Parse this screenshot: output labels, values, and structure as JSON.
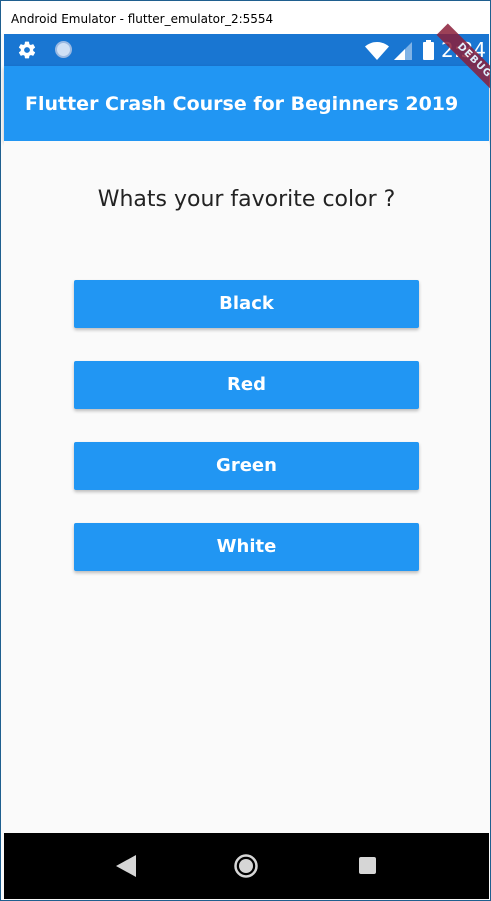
{
  "window": {
    "title": "Android Emulator - flutter_emulator_2:5554"
  },
  "status_bar": {
    "time": "2:34",
    "icons": [
      "gear-icon",
      "sync-indicator-icon",
      "wifi-icon",
      "signal-icon",
      "battery-icon"
    ],
    "color": "#1976d2"
  },
  "app_bar": {
    "title": "Flutter Crash Course for Beginners 2019",
    "debug_banner": "DEBUG",
    "color": "#2196f3"
  },
  "quiz": {
    "question": "Whats your favorite color ?",
    "answers": [
      "Black",
      "Red",
      "Green",
      "White"
    ]
  },
  "nav_bar": {
    "icons": [
      "back-icon",
      "home-icon",
      "recents-icon"
    ]
  }
}
